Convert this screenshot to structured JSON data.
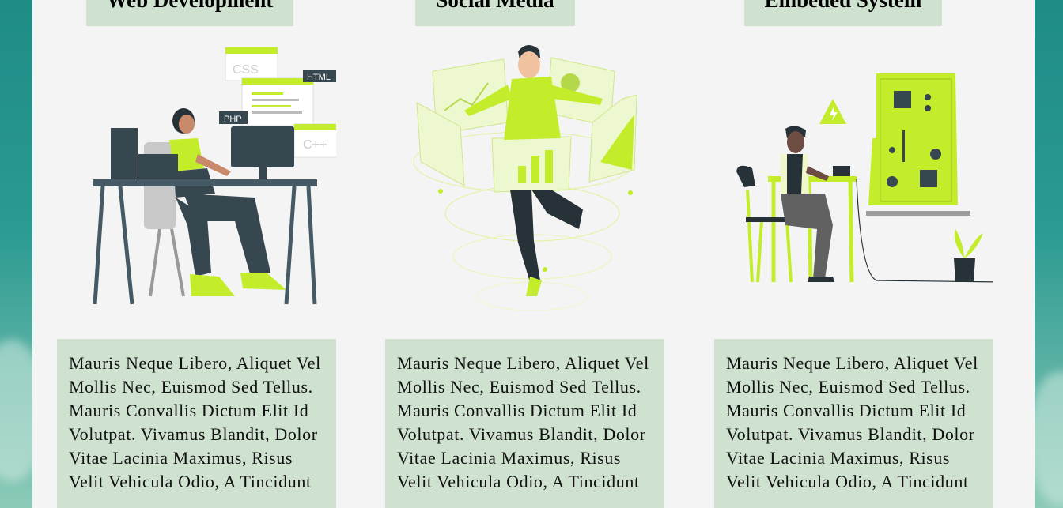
{
  "colors": {
    "accent": "#c3ec2a",
    "dark": "#37474f",
    "card_bg": "#cfe2d0",
    "panel_bg": "#f4f4f4"
  },
  "cards": [
    {
      "title": "Web Development",
      "illustration": "developer-at-desk-illustration",
      "code_tags": [
        "CSS",
        "HTML",
        "PHP",
        "C++"
      ],
      "description": "Mauris Neque Libero, Aliquet Vel Mollis Nec, Euismod Sed Tellus. Mauris Convallis Dictum Elit Id Volutpat. Vivamus Blandit, Dolor Vitae Lacinia Maximus, Risus Velit Vehicula Odio, A Tincidunt"
    },
    {
      "title": "Social Media",
      "illustration": "social-media-analyst-illustration",
      "description": "Mauris Neque Libero, Aliquet Vel Mollis Nec, Euismod Sed Tellus. Mauris Convallis Dictum Elit Id Volutpat. Vivamus Blandit, Dolor Vitae Lacinia Maximus, Risus Velit Vehicula Odio, A Tincidunt"
    },
    {
      "title": "Embeded System",
      "illustration": "embedded-engineer-illustration",
      "description": "Mauris Neque Libero, Aliquet Vel Mollis Nec, Euismod Sed Tellus. Mauris Convallis Dictum Elit Id Volutpat. Vivamus Blandit, Dolor Vitae Lacinia Maximus, Risus Velit Vehicula Odio, A Tincidunt"
    }
  ]
}
